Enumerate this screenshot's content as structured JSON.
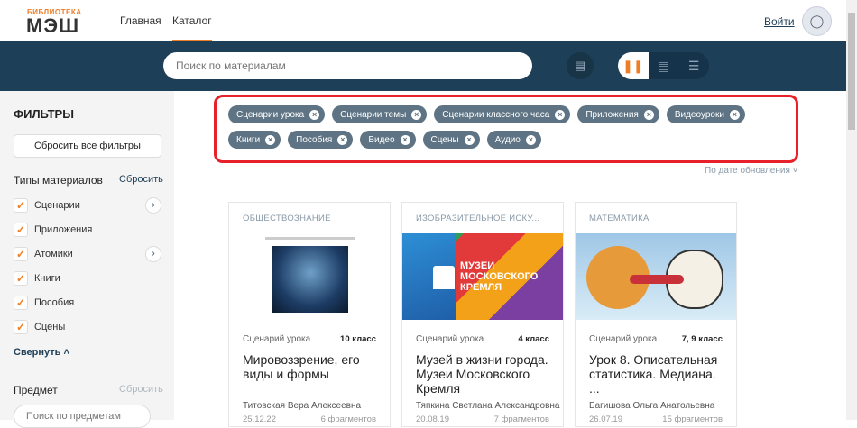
{
  "header": {
    "logo_top": "БИБЛИОТЕКА",
    "logo_main": "МЭШ",
    "nav": [
      "Главная",
      "Каталог"
    ],
    "active_nav": "Каталог",
    "login": "Войти"
  },
  "toolbar": {
    "search_placeholder": "Поиск по материалам"
  },
  "sidebar": {
    "title": "ФИЛЬТРЫ",
    "reset_all": "Сбросить все фильтры",
    "types": {
      "title": "Типы материалов",
      "reset": "Сбросить",
      "items": [
        {
          "label": "Сценарии",
          "checked": true
        },
        {
          "label": "Приложения",
          "checked": true
        },
        {
          "label": "Атомики",
          "checked": true
        },
        {
          "label": "Книги",
          "checked": true
        },
        {
          "label": "Пособия",
          "checked": true
        },
        {
          "label": "Сцены",
          "checked": true
        }
      ],
      "collapse": "Свернуть"
    },
    "subject": {
      "title": "Предмет",
      "reset": "Сбросить",
      "search_placeholder": "Поиск по предметам"
    }
  },
  "chips": [
    "Сценарии урока",
    "Сценарии темы",
    "Сценарии классного часа",
    "Приложения",
    "Видеоуроки",
    "Книги",
    "Пособия",
    "Видео",
    "Сцены",
    "Аудио"
  ],
  "sort": "По дате обновления",
  "cards": [
    {
      "subject": "ОБЩЕСТВОЗНАНИЕ",
      "type": "Сценарий урока",
      "grade": "10 класс",
      "title": "Мировоззрение, его виды и формы",
      "author": "Титовская Вера Алексеевна",
      "date": "25.12.22",
      "fragments": "6 фрагментов"
    },
    {
      "subject": "ИЗОБРАЗИТЕЛЬНОЕ ИСКУ...",
      "type": "Сценарий урока",
      "grade": "4 класс",
      "title": "Музей в жизни города. Музеи Московского Кремля",
      "author": "Тяпкина Светлана Александровна",
      "date": "20.08.19",
      "fragments": "7 фрагментов",
      "image_text": "МУЗЕИ МОСКОВСКОГО КРЕМЛЯ"
    },
    {
      "subject": "МАТЕМАТИКА",
      "type": "Сценарий урока",
      "grade": "7, 9 класс",
      "title": "Урок 8. Описательная статистика. Медиана. ...",
      "author": "Багишова Ольга Анатольевна",
      "date": "26.07.19",
      "fragments": "15 фрагментов"
    }
  ]
}
